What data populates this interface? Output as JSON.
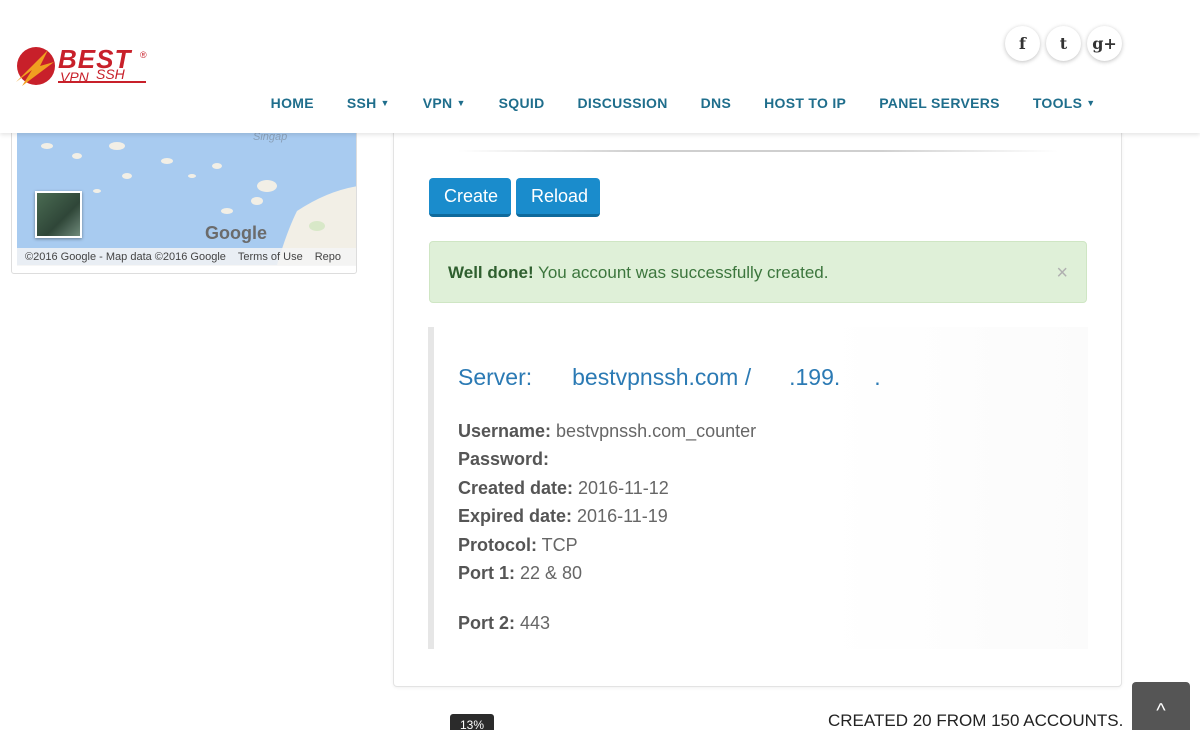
{
  "logo": {
    "best": "BEST",
    "vpn": "VPN",
    "ssh": "SSH",
    "reg": "®"
  },
  "social": [
    {
      "icon": "facebook-icon",
      "glyph": "f"
    },
    {
      "icon": "twitter-icon",
      "glyph": "t"
    },
    {
      "icon": "google-plus-icon",
      "glyph": "g+"
    }
  ],
  "nav": {
    "home": "HOME",
    "ssh": "SSH",
    "vpn": "VPN",
    "squid": "SQUID",
    "discussion": "DISCUSSION",
    "dns": "DNS",
    "host_to_ip": "HOST TO IP",
    "panel_servers": "PANEL SERVERS",
    "tools": "TOOLS",
    "caret": "▼"
  },
  "map": {
    "city": "Singap",
    "google": "Google",
    "copyright": "©2016 Google - Map data ©2016 Google",
    "terms": "Terms of Use",
    "report": "Repo"
  },
  "actions": {
    "create": "Create",
    "reload": "Reload"
  },
  "alert": {
    "strong": "Well done!",
    "message": " You account was successfully created.",
    "close": "×"
  },
  "account": {
    "server_label": "Server:",
    "server_host": "bestvpnssh.com /",
    "server_ip_part1": ".199.",
    "server_ip_part2": ".",
    "username_label": "Username:",
    "username_value": " bestvpnssh.com_counter",
    "password_label": "Password:",
    "created_label": "Created date:",
    "created_value": " 2016-11-12",
    "expired_label": "Expired date:",
    "expired_value": " 2016-11-19",
    "protocol_label": "Protocol:",
    "protocol_value": " TCP",
    "port1_label": "Port 1:",
    "port1_value": " 22 & 80",
    "port2_label": "Port 2:",
    "port2_value": " 443"
  },
  "stats": {
    "progress_percent": "13%",
    "created_text": "CREATED 20 FROM 150 ACCOUNTS."
  },
  "scroll_top": "^"
}
